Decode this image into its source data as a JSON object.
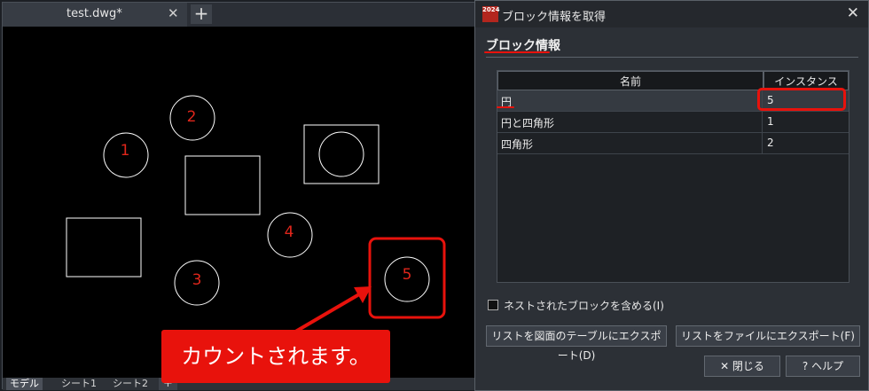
{
  "cad": {
    "tab_name": "test.dwg*",
    "tab_close": "✕",
    "tab_add": "+",
    "circle_numbers": [
      "1",
      "2",
      "3",
      "4",
      "5"
    ],
    "layout_tabs": [
      "モデル",
      "シート1",
      "シート2"
    ],
    "layout_add": "+"
  },
  "callout": {
    "text": "カウントされます。"
  },
  "dialog": {
    "app_icon_text": "2024",
    "title": "ブロック情報を取得",
    "close": "✕",
    "group_title": "ブロック情報",
    "columns": [
      "名前",
      "インスタンス"
    ],
    "rows": [
      {
        "name": "円",
        "count": "5"
      },
      {
        "name": "円と四角形",
        "count": "1"
      },
      {
        "name": "四角形",
        "count": "2"
      }
    ],
    "nested_checkbox_label": "ネストされたブロックを含める(I)",
    "export_table_button": "リストを図面のテーブルにエクスポート(D)",
    "export_file_button": "リストをファイルにエクスポート(F)",
    "close_button": "✕ 閉じる",
    "help_button": "? ヘルプ"
  },
  "colors": {
    "highlight": "#e8120c",
    "annotation_number": "#e0261b"
  }
}
